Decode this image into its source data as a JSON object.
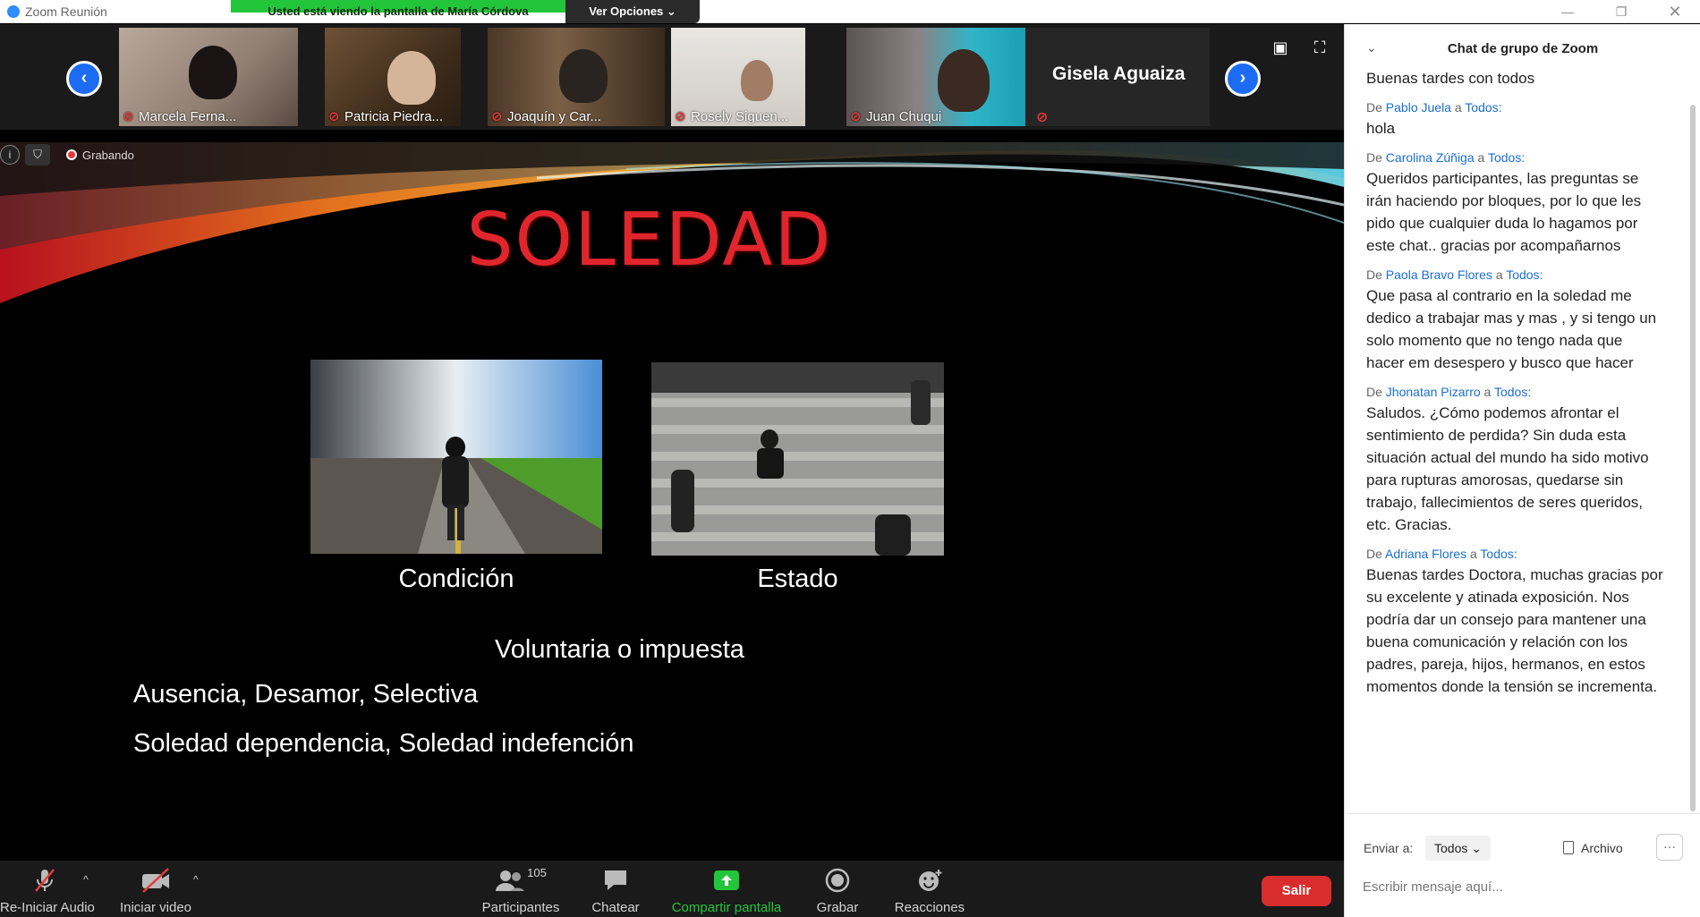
{
  "window": {
    "title": "Zoom Reunión"
  },
  "share_banner": {
    "message": "Usted está viendo la pantalla de María Córdova",
    "options_label": "Ver Opciones ⌄"
  },
  "participants_strip": {
    "tiles": [
      {
        "name": "Marcela Ferna..."
      },
      {
        "name": "Patricia Piedra..."
      },
      {
        "name": "Joaquín y Car..."
      },
      {
        "name": "Rosely Siguen..."
      },
      {
        "name": "Juan Chuqui"
      }
    ],
    "name_tile": "Gisela Aguaiza"
  },
  "recording": {
    "label": "Grabando"
  },
  "slide": {
    "title": "SOLEDAD",
    "caption_left": "Condición",
    "caption_right": "Estado",
    "line1": "Voluntaria o impuesta",
    "line2": "Ausencia, Desamor, Selectiva",
    "line3": "Soledad dependencia, Soledad indefención"
  },
  "toolbar": {
    "audio_label": "Re-Iniciar Audio",
    "video_label": "Iniciar video",
    "participants_label": "Participantes",
    "participants_count": "105",
    "chat_label": "Chatear",
    "share_label": "Compartir pantalla",
    "record_label": "Grabar",
    "reactions_label": "Reacciones",
    "leave_label": "Salir"
  },
  "chat": {
    "title": "Chat de grupo de Zoom",
    "first_message": "Buenas tardes con todos",
    "from_word": "De",
    "to_word": "a",
    "messages": [
      {
        "sender": "Pablo Juela",
        "recipient": "Todos:",
        "text": "hola"
      },
      {
        "sender": "Carolina Zúñiga",
        "recipient": "Todos:",
        "text": "Queridos participantes, las preguntas se irán haciendo por bloques, por lo que les pido que cualquier duda lo hagamos por este chat.. gracias por acompañarnos"
      },
      {
        "sender": "Paola Bravo Flores",
        "recipient": "Todos:",
        "text": "Que pasa al contrario en la soledad me dedico a trabajar mas y mas , y si tengo un solo momento  que no tengo nada que hacer em desespero y busco que hacer"
      },
      {
        "sender": "Jhonatan Pizarro",
        "recipient": "Todos:",
        "text": "Saludos. ¿Cómo podemos afrontar el sentimiento de perdida? Sin duda esta situación actual del mundo ha sido motivo para rupturas amorosas, quedarse sin trabajo, fallecimientos de seres queridos, etc. Gracias."
      },
      {
        "sender": "Adriana Flores",
        "recipient": "Todos:",
        "text": "Buenas tardes Doctora, muchas gracias por su excelente y atinada exposición. Nos podría dar un consejo para mantener una buena comunicación y relación con los padres, pareja, hijos, hermanos, en estos momentos donde la tensión se incrementa."
      }
    ],
    "send_to_label": "Enviar a:",
    "send_to_value": "Todos ⌄",
    "file_label": "Archivo",
    "more_label": "···",
    "input_placeholder": "Escribir mensaje aquí..."
  }
}
